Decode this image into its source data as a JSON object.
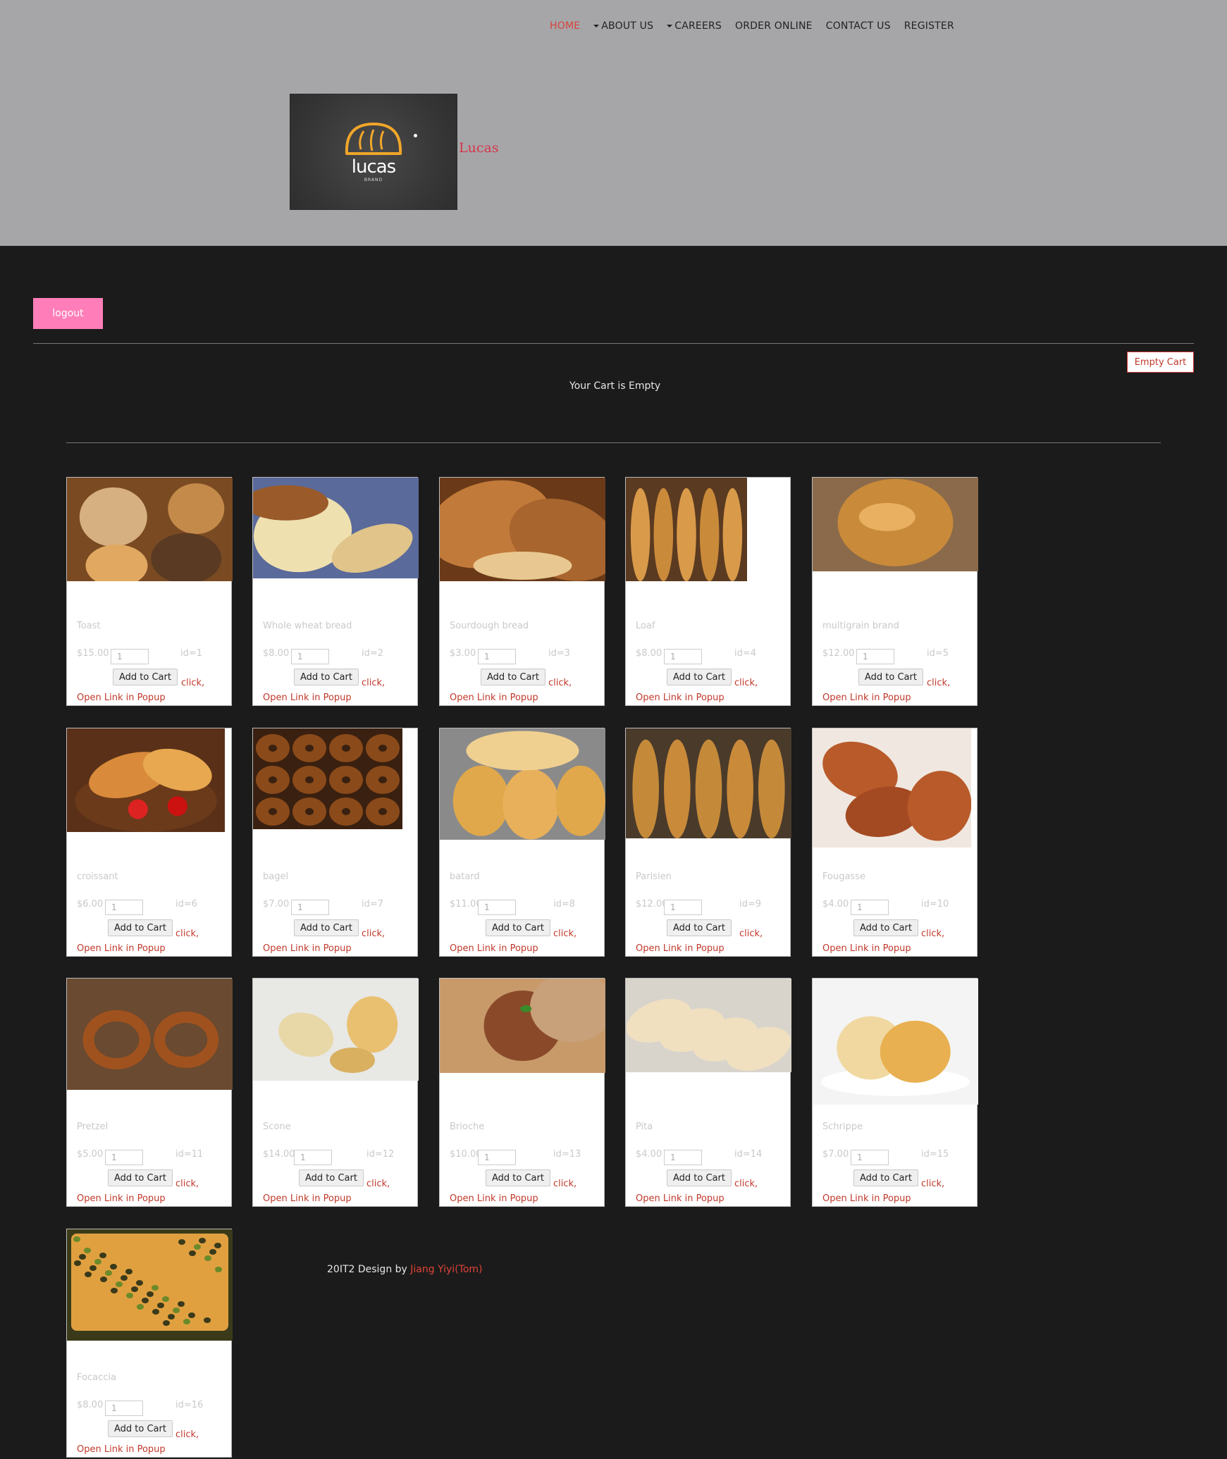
{
  "nav": {
    "items": [
      {
        "label": "HOME",
        "active": true,
        "dropdown": false
      },
      {
        "label": "ABOUT US",
        "active": false,
        "dropdown": true
      },
      {
        "label": "CAREERS",
        "active": false,
        "dropdown": true
      },
      {
        "label": "ORDER ONLINE",
        "active": false,
        "dropdown": false
      },
      {
        "label": "CONTACT US",
        "active": false,
        "dropdown": false
      },
      {
        "label": "REGISTER",
        "active": false,
        "dropdown": false
      }
    ]
  },
  "logo": {
    "word": "lucas",
    "sub": "BRAND",
    "icon": "bread-logo-icon"
  },
  "brand_name": "Lucas",
  "logout_label": "logout",
  "cart": {
    "empty_button": "Empty Cart",
    "status": "Your Cart is Empty"
  },
  "product_common": {
    "qty_default": "1",
    "add_label": "Add to Cart",
    "click_label": "click,",
    "popup_label": "Open Link in Popup"
  },
  "products": [
    {
      "name": "Toast",
      "price": "$15.00",
      "id": "id=1",
      "tone": [
        "#c48a4a",
        "#7a4a22"
      ],
      "img": "round-rolls"
    },
    {
      "name": "Whole wheat bread",
      "price": "$8.00",
      "id": "id=2",
      "tone": [
        "#e0c48a",
        "#8a5a2a"
      ],
      "img": "loaf-sliced"
    },
    {
      "name": "Sourdough bread",
      "price": "$3.00",
      "id": "id=3",
      "tone": [
        "#c27a3a",
        "#6a3a18"
      ],
      "img": "crusty"
    },
    {
      "name": "Loaf",
      "price": "$8.00",
      "id": "id=4",
      "tone": [
        "#d99a4a",
        "#5a3a20"
      ],
      "img": "baguettes"
    },
    {
      "name": "multigrain brand",
      "price": "$12.00",
      "id": "id=5",
      "tone": [
        "#c98a3a",
        "#8a6a4a"
      ],
      "img": "round-loaf"
    },
    {
      "name": "croissant",
      "price": "$6.00",
      "id": "id=6",
      "tone": [
        "#d98a3a",
        "#5a3018"
      ],
      "img": "croissant"
    },
    {
      "name": "bagel",
      "price": "$7.00",
      "id": "id=7",
      "tone": [
        "#8a4a1a",
        "#3a2010"
      ],
      "img": "bagels"
    },
    {
      "name": "batard",
      "price": "$11.00",
      "id": "id=8",
      "tone": [
        "#e0a84a",
        "#8a8a8a"
      ],
      "img": "rolls"
    },
    {
      "name": "Parisien",
      "price": "$12.00",
      "id": "id=9",
      "tone": [
        "#c48a3a",
        "#4a3a2a"
      ],
      "img": "baguettes"
    },
    {
      "name": "Fougasse",
      "price": "$4.00",
      "id": "id=10",
      "tone": [
        "#b85a2a",
        "#f0e8e0"
      ],
      "img": "fougasse"
    },
    {
      "name": "Pretzel",
      "price": "$5.00",
      "id": "id=11",
      "tone": [
        "#a0521e",
        "#6a4a30"
      ],
      "img": "pretzel"
    },
    {
      "name": "Scone",
      "price": "$14.00",
      "id": "id=12",
      "tone": [
        "#e8d8a8",
        "#e8e8e4"
      ],
      "img": "scone"
    },
    {
      "name": "Brioche",
      "price": "$10.00",
      "id": "id=13",
      "tone": [
        "#8a4a2a",
        "#c89a6a"
      ],
      "img": "brioche"
    },
    {
      "name": "Pita",
      "price": "$4.00",
      "id": "id=14",
      "tone": [
        "#f0e0c0",
        "#d8d4cc"
      ],
      "img": "pita"
    },
    {
      "name": "Schrippe",
      "price": "$7.00",
      "id": "id=15",
      "tone": [
        "#e8b050",
        "#f4f4f4"
      ],
      "img": "bun"
    },
    {
      "name": "Focaccia",
      "price": "$8.00",
      "id": "id=16",
      "tone": [
        "#e0a040",
        "#3a3a1a"
      ],
      "img": "focaccia"
    }
  ],
  "footer": {
    "text": "20IT2 Design by ",
    "link": "Jiang Yiyi(Tom)"
  }
}
